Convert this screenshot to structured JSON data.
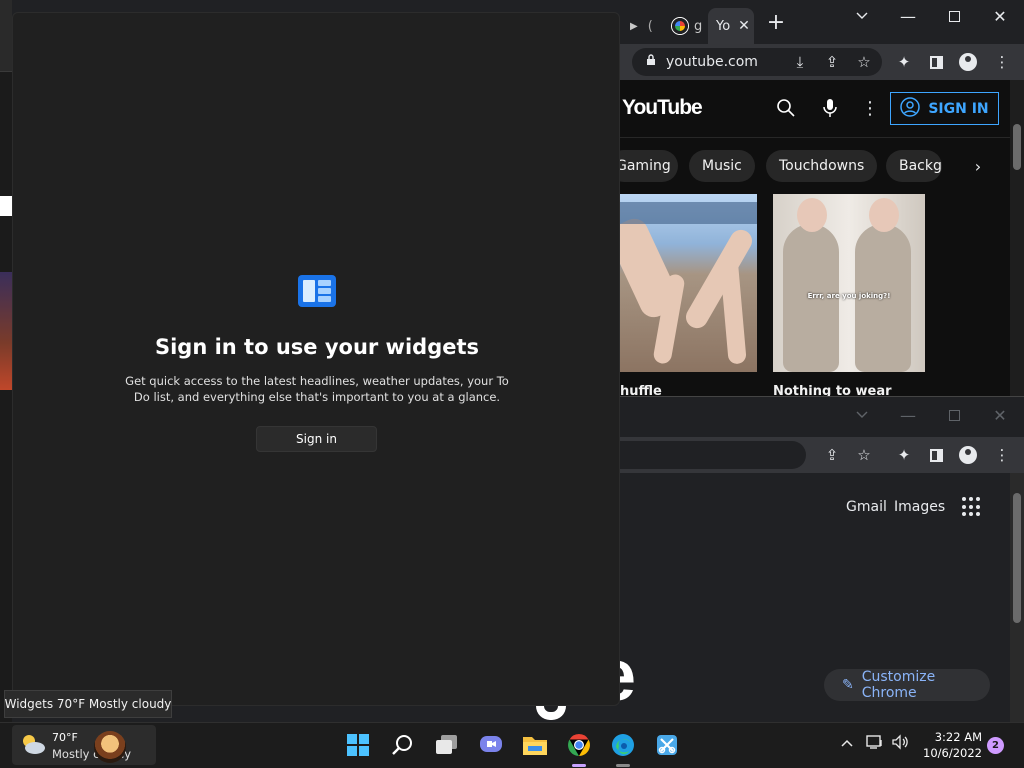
{
  "browser_top": {
    "tab_fragment_2": "g",
    "active_tab_label": "Yo",
    "address": "youtube.com",
    "youtube": {
      "logo_text": "YouTube",
      "signin_label": "SIGN IN",
      "chips": [
        "Gaming",
        "Music",
        "Touchdowns",
        "Backg"
      ],
      "videos": [
        {
          "title": "huffle"
        },
        {
          "title": "Nothing to wear",
          "caption": "Errr, are you joking?!"
        }
      ]
    }
  },
  "browser_bottom": {
    "links": [
      "Gmail",
      "Images"
    ],
    "customize_label": "Customize Chrome",
    "logo_fragment": "e"
  },
  "widgets": {
    "title": "Sign in to use your widgets",
    "description": "Get quick access to the latest headlines, weather updates, your To Do list, and everything else that's important to you at a glance.",
    "signin_label": "Sign in"
  },
  "tooltip": "Widgets 70°F Mostly cloudy",
  "taskbar": {
    "weather_temp": "70°F",
    "weather_cond": "Mostly cloudy",
    "time": "3:22 AM",
    "date": "10/6/2022",
    "notification_count": "2"
  }
}
